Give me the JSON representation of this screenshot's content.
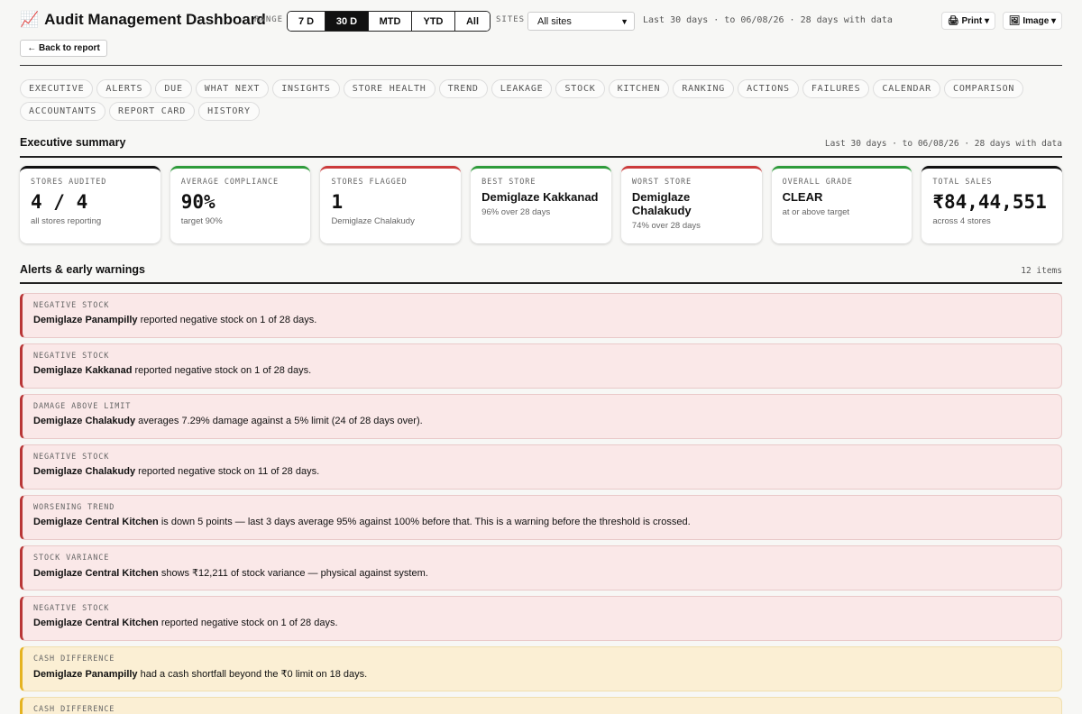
{
  "header": {
    "title_icon": "📈",
    "title": "Audit Management Dashboard",
    "range_label": "RANGE",
    "ranges": [
      "7 D",
      "30 D",
      "MTD",
      "YTD",
      "All"
    ],
    "active_range": "30 D",
    "sites_label": "SITES",
    "sites_value": "All sites",
    "range_info": "Last 30 days · to 06/08/26 · 28 days with data",
    "print_label": "🖨 Print ▾",
    "image_label": "🖼 Image ▾"
  },
  "back_label": "← Back to report",
  "tabs": [
    "EXECUTIVE",
    "ALERTS",
    "DUE",
    "WHAT NEXT",
    "INSIGHTS",
    "STORE HEALTH",
    "TREND",
    "LEAKAGE",
    "STOCK",
    "KITCHEN",
    "RANKING",
    "ACTIONS",
    "FAILURES",
    "CALENDAR",
    "COMPARISON",
    "ACCOUNTANTS",
    "REPORT CARD",
    "HISTORY"
  ],
  "executive": {
    "title": "Executive summary",
    "meta": "Last 30 days · to 06/08/26 · 28 days with data",
    "cards": [
      {
        "label": "STORES AUDITED",
        "value": "4 / 4",
        "sub": "all stores reporting",
        "accent": "black"
      },
      {
        "label": "AVERAGE COMPLIANCE",
        "value": "90%",
        "sub": "target 90%",
        "accent": "green"
      },
      {
        "label": "STORES FLAGGED",
        "value": "1",
        "sub": "Demiglaze Chalakudy",
        "accent": "red"
      },
      {
        "label": "BEST STORE",
        "value": "Demiglaze Kakkanad",
        "sub": "96% over 28 days",
        "accent": "green",
        "style": "mid"
      },
      {
        "label": "WORST STORE",
        "value": "Demiglaze Chalakudy",
        "sub": "74% over 28 days",
        "accent": "red",
        "style": "mid"
      },
      {
        "label": "OVERALL GRADE",
        "value": "CLEAR",
        "sub": "at or above target",
        "accent": "green",
        "style": "mid"
      },
      {
        "label": "TOTAL SALES",
        "value": "₹84,44,551",
        "sub": "across 4 stores",
        "accent": "black"
      }
    ]
  },
  "alerts_section": {
    "title": "Alerts & early warnings",
    "count": "12 items",
    "items": [
      {
        "type": "NEGATIVE STOCK",
        "store": "Demiglaze Panampilly",
        "text": " reported negative stock on 1 of 28 days.",
        "level": "danger"
      },
      {
        "type": "NEGATIVE STOCK",
        "store": "Demiglaze Kakkanad",
        "text": " reported negative stock on 1 of 28 days.",
        "level": "danger"
      },
      {
        "type": "DAMAGE ABOVE LIMIT",
        "store": "Demiglaze Chalakudy",
        "text": " averages 7.29% damage against a 5% limit (24 of 28 days over).",
        "level": "danger"
      },
      {
        "type": "NEGATIVE STOCK",
        "store": "Demiglaze Chalakudy",
        "text": " reported negative stock on 11 of 28 days.",
        "level": "danger"
      },
      {
        "type": "WORSENING TREND",
        "store": "Demiglaze Central Kitchen",
        "text": " is down 5 points — last 3 days average 95% against 100% before that. This is a warning before the threshold is crossed.",
        "level": "danger"
      },
      {
        "type": "STOCK VARIANCE",
        "store": "Demiglaze Central Kitchen",
        "text": " shows ₹12,211 of stock variance — physical against system.",
        "level": "danger"
      },
      {
        "type": "NEGATIVE STOCK",
        "store": "Demiglaze Central Kitchen",
        "text": " reported negative stock on 1 of 28 days.",
        "level": "danger"
      },
      {
        "type": "CASH DIFFERENCE",
        "store": "Demiglaze Panampilly",
        "text": " had a cash shortfall beyond the ₹0 limit on 18 days.",
        "level": "warn"
      },
      {
        "type": "CASH DIFFERENCE",
        "store": "",
        "text": "",
        "level": "warn"
      }
    ]
  }
}
